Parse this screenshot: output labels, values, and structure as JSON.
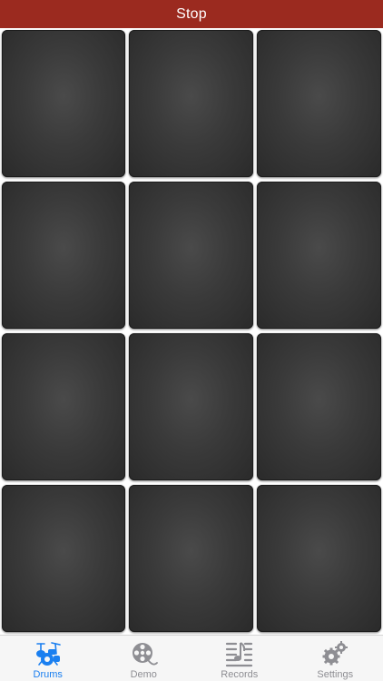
{
  "header": {
    "stop_label": "Stop"
  },
  "pads": [
    {
      "name": "pad-1"
    },
    {
      "name": "pad-2"
    },
    {
      "name": "pad-3"
    },
    {
      "name": "pad-4"
    },
    {
      "name": "pad-5"
    },
    {
      "name": "pad-6"
    },
    {
      "name": "pad-7"
    },
    {
      "name": "pad-8"
    },
    {
      "name": "pad-9"
    },
    {
      "name": "pad-10"
    },
    {
      "name": "pad-11"
    },
    {
      "name": "pad-12"
    }
  ],
  "tabs": [
    {
      "label": "Drums",
      "icon": "drum-kit-icon",
      "active": true
    },
    {
      "label": "Demo",
      "icon": "film-reel-icon",
      "active": false
    },
    {
      "label": "Records",
      "icon": "music-list-icon",
      "active": false
    },
    {
      "label": "Settings",
      "icon": "gears-icon",
      "active": false
    }
  ],
  "colors": {
    "header_bg": "#9b2a1f",
    "pad_bg": "#333333",
    "tab_active": "#1a7ff0",
    "tab_inactive": "#8e8e93"
  }
}
